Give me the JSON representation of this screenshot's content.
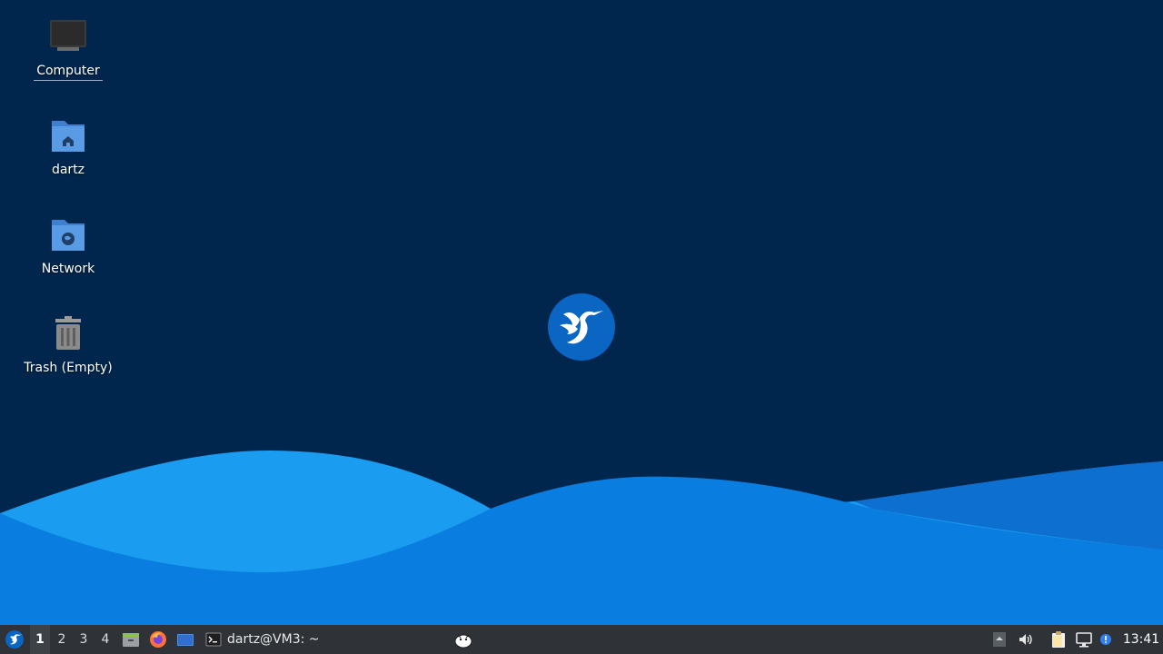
{
  "desktop": {
    "icons": [
      {
        "label": "Computer"
      },
      {
        "label": "dartz"
      },
      {
        "label": "Network"
      },
      {
        "label": "Trash (Empty)"
      }
    ]
  },
  "taskbar": {
    "workspaces": [
      "1",
      "2",
      "3",
      "4"
    ],
    "active_workspace": "1",
    "task_title": "dartz@VM3: ~",
    "clock": "13:41"
  },
  "colors": {
    "background": "#00264d",
    "wave_light": "#1a9cf0",
    "wave_dark": "#0a72d6",
    "panel": "#2f3338",
    "accent": "#0a66c2"
  }
}
